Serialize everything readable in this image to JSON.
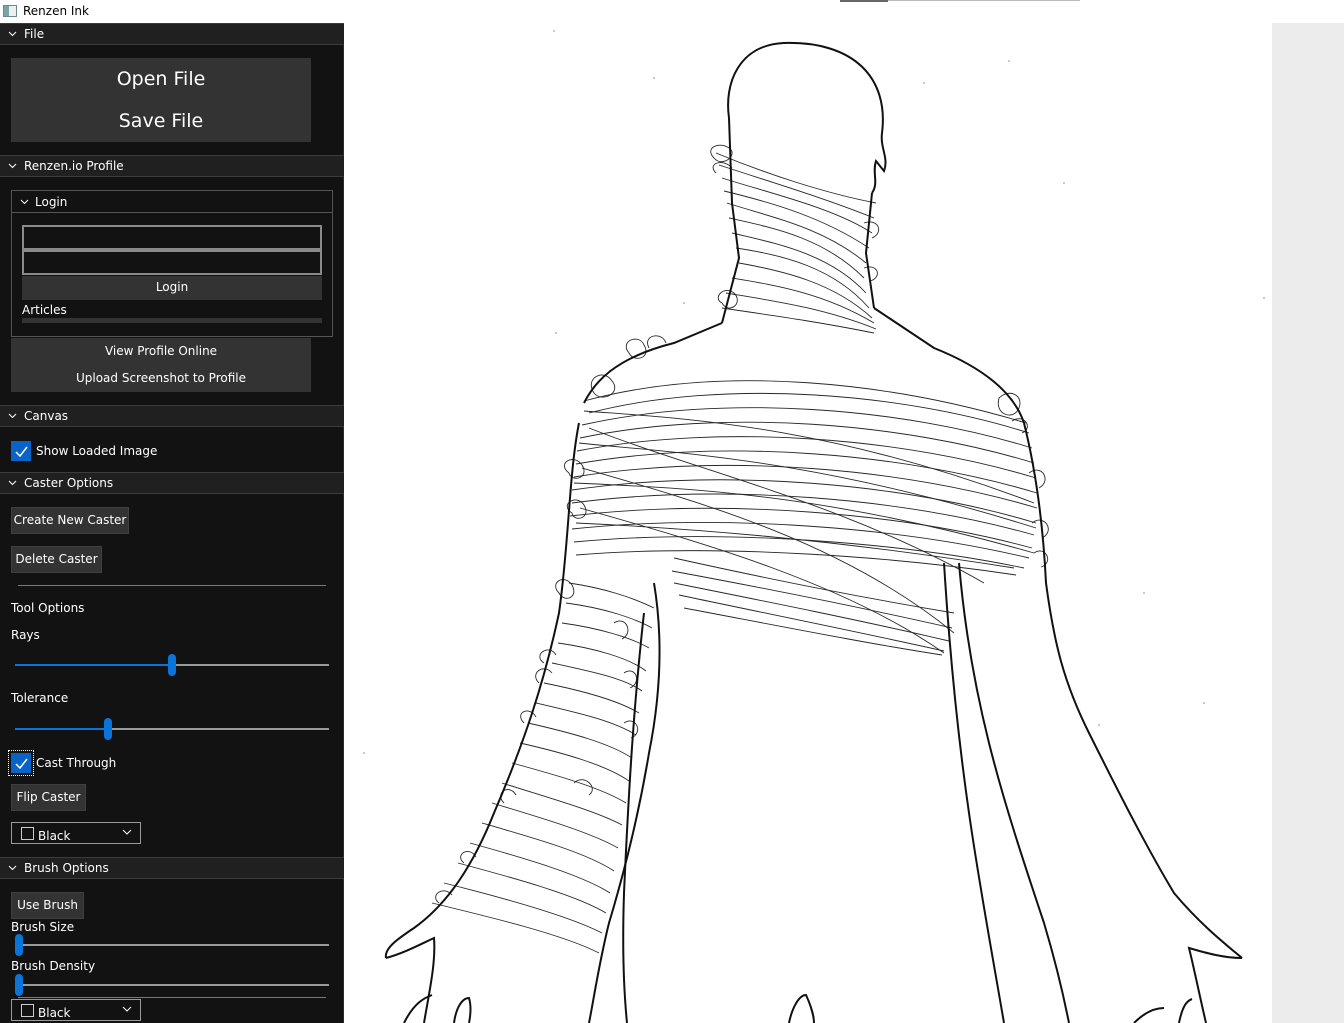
{
  "app": {
    "title": "Renzen Ink"
  },
  "file_section": {
    "header": "File",
    "open_label": "Open File",
    "save_label": "Save File"
  },
  "profile_section": {
    "header": "Renzen.io Profile",
    "login_group": {
      "header": "Login",
      "username_value": "",
      "password_value": "",
      "login_label": "Login",
      "articles_label": "Articles"
    },
    "view_profile_label": "View Profile Online",
    "upload_label": "Upload Screenshot to Profile"
  },
  "canvas_section": {
    "header": "Canvas",
    "show_loaded_image_label": "Show Loaded Image",
    "show_loaded_image_checked": true
  },
  "caster_section": {
    "header": "Caster Options",
    "create_label": "Create New Caster",
    "delete_label": "Delete Caster",
    "tool_options_label": "Tool Options",
    "rays_label": "Rays",
    "rays_level": 0.5,
    "tolerance_label": "Tolerance",
    "tolerance_level": 0.29,
    "cast_through_label": "Cast Through",
    "cast_through_checked": true,
    "flip_label": "Flip Caster",
    "color_value": "Black"
  },
  "brush_section": {
    "header": "Brush Options",
    "use_brush_label": "Use Brush",
    "size_label": "Brush Size",
    "size_level": 0.0,
    "density_label": "Brush Density",
    "density_level": 0.0,
    "color_value": "Black"
  },
  "colors": {
    "accent": "#0a74d8",
    "panel": "#121212",
    "header": "#202020",
    "button": "#333333"
  }
}
